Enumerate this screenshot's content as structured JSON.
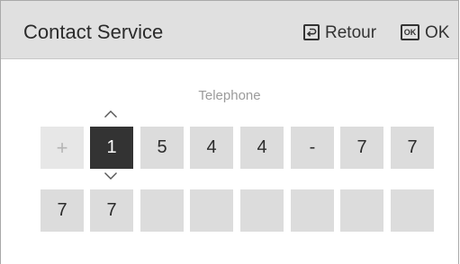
{
  "header": {
    "title": "Contact Service",
    "back_icon": "return-icon",
    "back_label": "Retour",
    "ok_icon_text": "OK",
    "ok_label": "OK"
  },
  "field": {
    "label": "Telephone",
    "up_icon": "chevron-up-icon",
    "down_icon": "chevron-down-icon",
    "row1": [
      "+",
      "1",
      "5",
      "4",
      "4",
      "-",
      "7",
      "7"
    ],
    "row2": [
      "7",
      "7",
      "",
      "",
      "",
      "",
      "",
      ""
    ],
    "active_cell": "1"
  },
  "colors": {
    "header_bg": "#e0e0e0",
    "cell_bg": "#dcdcdc",
    "active_cell_bg": "#333333",
    "label_gray": "#9b9b9b"
  }
}
